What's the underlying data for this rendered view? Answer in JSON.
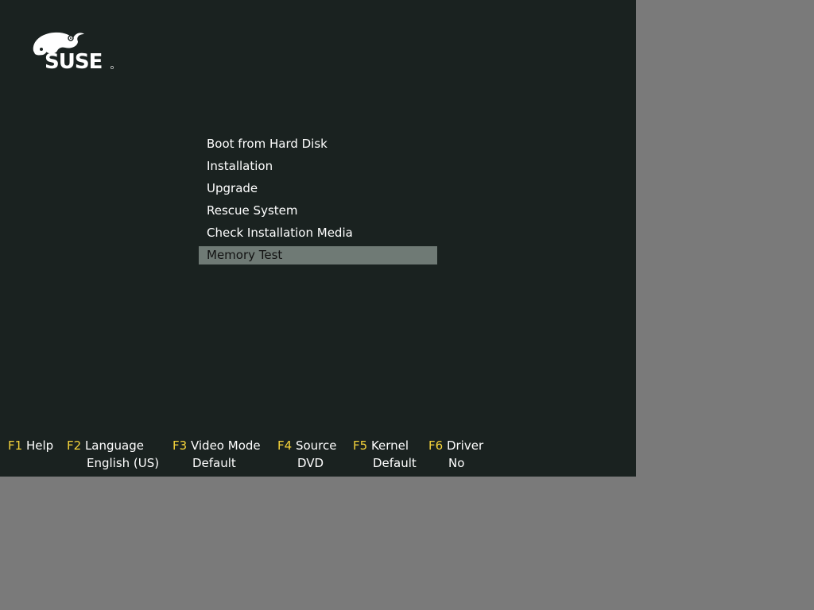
{
  "brand": {
    "name": "SUSE"
  },
  "menu": {
    "items": [
      {
        "label": "Boot from Hard Disk"
      },
      {
        "label": "Installation"
      },
      {
        "label": "Upgrade"
      },
      {
        "label": "Rescue System"
      },
      {
        "label": "Check Installation Media"
      },
      {
        "label": "Memory Test"
      }
    ],
    "selected_index": 5
  },
  "function_keys": [
    {
      "key": "F1",
      "label": "Help",
      "value": ""
    },
    {
      "key": "F2",
      "label": "Language",
      "value": "English (US)"
    },
    {
      "key": "F3",
      "label": "Video Mode",
      "value": "Default"
    },
    {
      "key": "F4",
      "label": "Source",
      "value": "DVD"
    },
    {
      "key": "F5",
      "label": "Kernel",
      "value": "Default"
    },
    {
      "key": "F6",
      "label": "Driver",
      "value": "No"
    }
  ],
  "colors": {
    "screen_background": "#1a2220",
    "outer_background": "#7a7a7a",
    "selection_background": "#6f7a75",
    "function_key_color": "#f5d33a",
    "text_color": "#ffffff"
  }
}
